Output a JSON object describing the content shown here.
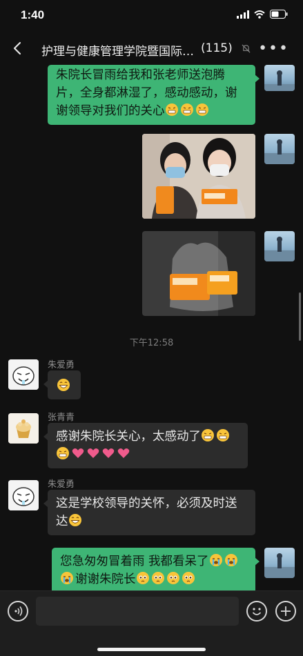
{
  "status_bar": {
    "time": "1:40"
  },
  "nav": {
    "title": "护理与健康管理学院暨国际…",
    "member_count": "(115)"
  },
  "messages": {
    "m1_text": "朱院长冒雨给我和张老师送泡腾片，全身都淋湿了，感动感动，谢谢领导对我们的关心",
    "timestamp": "下午12:58",
    "m4_sender": "朱爱勇",
    "m5_sender": "张青青",
    "m5_text": "感谢朱院长关心，太感动了",
    "m6_sender": "朱爱勇",
    "m6_text": "这是学校领导的关怀，必须及时送达",
    "m7_text_a": "您急匆匆冒着雨 我都看呆了",
    "m7_text_b": "谢谢朱院长"
  },
  "icons": {
    "back": "chevron-left-icon",
    "mute": "mute-bell-icon",
    "more": "more-dots-icon",
    "voice": "voice-icon",
    "emoji": "emoji-icon",
    "plus": "plus-icon"
  },
  "colors": {
    "self_bubble": "#3eb575",
    "other_bubble": "#2c2c2c",
    "background": "#111111"
  }
}
